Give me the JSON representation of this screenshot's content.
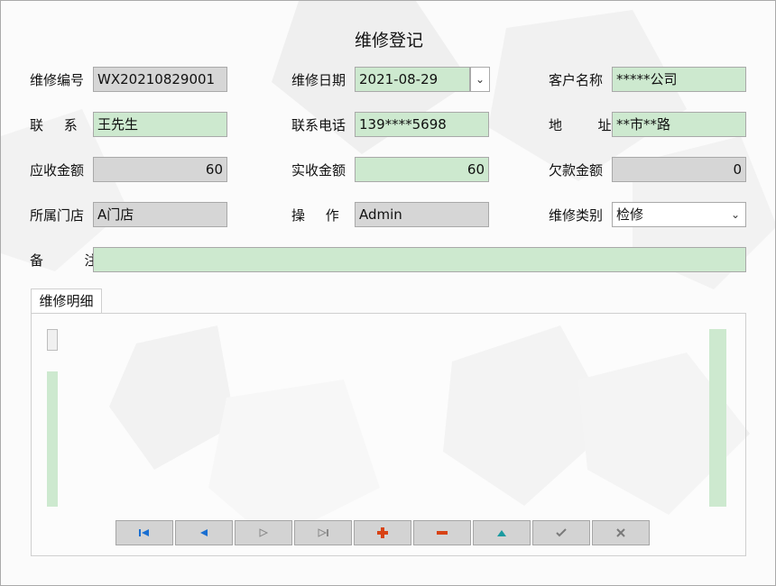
{
  "form": {
    "title": "维修登记",
    "repair_no": {
      "label": "维修编号",
      "value": "WX20210829001"
    },
    "repair_date": {
      "label": "维修日期",
      "value": "2021-08-29"
    },
    "customer": {
      "label": "客户名称",
      "value": "*****公司"
    },
    "contact": {
      "label": "联 系 人",
      "value": "王先生"
    },
    "phone": {
      "label": "联系电话",
      "value": "139****5698"
    },
    "address": {
      "label": "地  址",
      "value": "**市**路"
    },
    "receivable": {
      "label": "应收金额",
      "value": "60"
    },
    "received": {
      "label": "实收金额",
      "value": "60"
    },
    "owed": {
      "label": "欠款金额",
      "value": "0"
    },
    "store": {
      "label": "所属门店",
      "value": "A门店"
    },
    "operator": {
      "label": "操 作 员",
      "value": "Admin"
    },
    "repair_type": {
      "label": "维修类别",
      "value": "检修"
    },
    "remarks": {
      "label": "备  注",
      "value": ""
    }
  },
  "details": {
    "tab_label": "维修明细"
  },
  "navigator": {
    "buttons": [
      "first",
      "prior",
      "next",
      "last",
      "insert",
      "delete",
      "edit",
      "post",
      "cancel"
    ]
  },
  "colors": {
    "editable_field": "#cde9cf",
    "readonly_field": "#d6d6d6",
    "nav_blue": "#1a6fd1",
    "nav_red": "#d84315",
    "nav_teal": "#1a9aa0",
    "nav_disabled": "#8a8a8a"
  }
}
